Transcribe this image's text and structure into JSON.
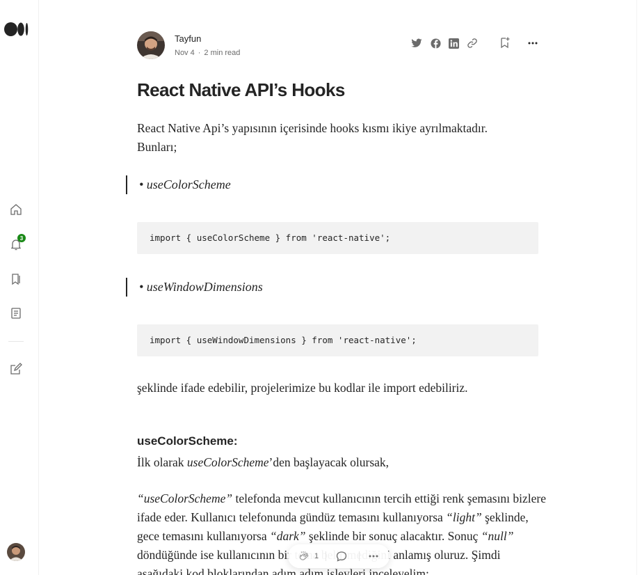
{
  "author": {
    "name": "Tayfun",
    "date": "Nov 4",
    "separator": "·",
    "read_time": "2 min read"
  },
  "rail": {
    "notification_count": "3",
    "icons": [
      "medium-logo",
      "home-icon",
      "bell-icon",
      "bookmarks-icon",
      "stories-icon",
      "write-icon"
    ]
  },
  "share_actions": [
    "twitter-icon",
    "facebook-icon",
    "linkedin-icon",
    "link-icon",
    "bookmark-add-icon",
    "more-icon"
  ],
  "article": {
    "title": "React Native API’s Hooks",
    "intro": "React Native Api’s yapısının içerisinde hooks kısmı ikiye ayrılmaktadır. Bunları;",
    "quote1": "• useColorScheme",
    "code1": "import { useColorScheme } from 'react-native';",
    "quote2": "• useWindowDimensions",
    "code2": "import { useWindowDimensions } from 'react-native';",
    "para2": "şeklinde ifade edebilir, projelerimize bu kodlar ile import edebiliriz.",
    "heading": "useColorScheme:",
    "para3_pre": "İlk olarak ",
    "para3_italic": "useColorScheme",
    "para3_post": "’den başlayacak olursak,",
    "para4_parts": {
      "q1": "“useColorScheme”",
      "t1": " telefonda mevcut kullanıcının tercih ettiği renk şemasını bizlere ifade eder. Kullanıcı telefonunda gündüz temasını kullanıyorsa ",
      "q2": "“light”",
      "t2": " şeklinde, gece temasını kullanıyorsa ",
      "q3": "“dark”",
      "t3": " şeklinde bir sonuç alacaktır. Sonuç ",
      "q4": "“null”",
      "t4": " döndüğünde ise kullanıcının bir tema belirtmediğini anlamış oluruz. Şimdi aşağıdaki kod bloklarından adım adım işleyleri inceleyelim;"
    }
  },
  "float_bar": {
    "clap_count": "1"
  },
  "colors": {
    "accent_green": "#1a8917",
    "text": "#242424",
    "muted": "#6b6b6b",
    "code_bg": "#f2f2f2"
  }
}
